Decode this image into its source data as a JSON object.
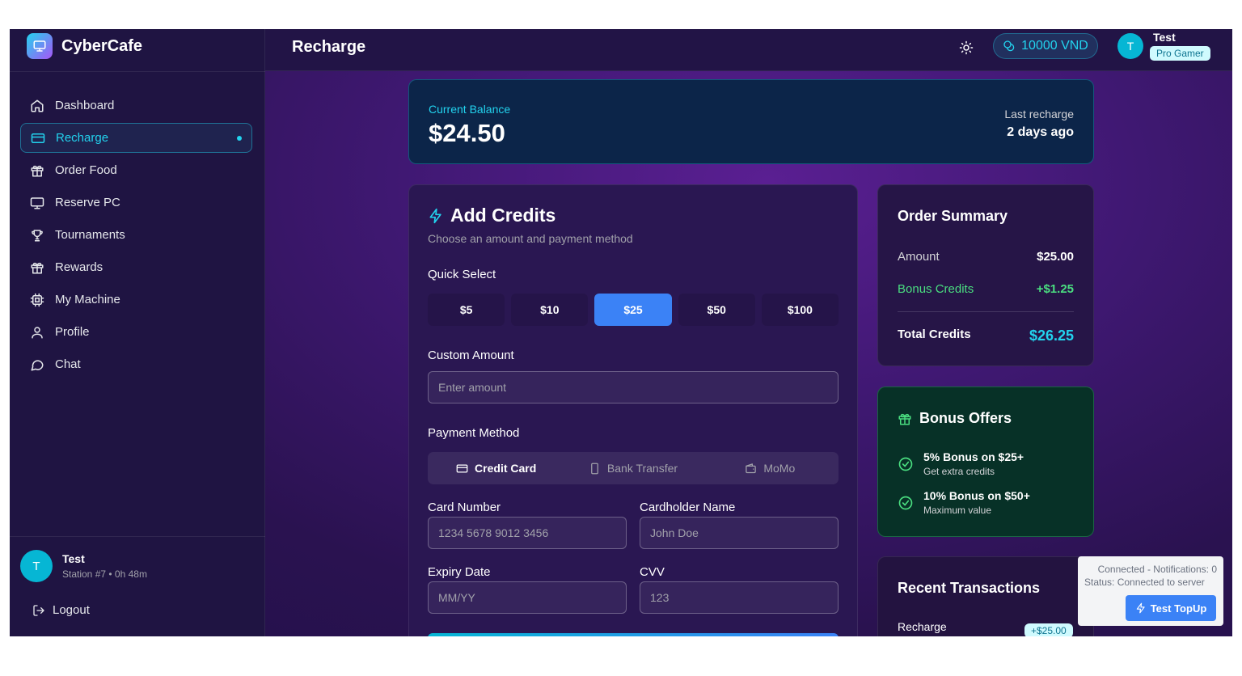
{
  "brand": {
    "name": "CyberCafe"
  },
  "header": {
    "title": "Recharge",
    "balance": "10000 VND",
    "user_initial": "T",
    "user_name": "Test",
    "user_badge": "Pro Gamer"
  },
  "sidebar": {
    "items": [
      {
        "label": "Dashboard",
        "icon": "home-icon"
      },
      {
        "label": "Recharge",
        "icon": "credit-card-icon",
        "active": true
      },
      {
        "label": "Order Food",
        "icon": "gift-icon"
      },
      {
        "label": "Reserve PC",
        "icon": "monitor-icon"
      },
      {
        "label": "Tournaments",
        "icon": "trophy-icon"
      },
      {
        "label": "Rewards",
        "icon": "gift-icon"
      },
      {
        "label": "My Machine",
        "icon": "cpu-icon"
      },
      {
        "label": "Profile",
        "icon": "user-icon"
      },
      {
        "label": "Chat",
        "icon": "chat-icon"
      }
    ],
    "user": {
      "initial": "T",
      "name": "Test",
      "status": "Station #7 • 0h 48m"
    },
    "logout": "Logout"
  },
  "balance_card": {
    "label": "Current Balance",
    "amount": "$24.50",
    "last_label": "Last recharge",
    "last_value": "2 days ago"
  },
  "credits": {
    "title": "Add Credits",
    "subtitle": "Choose an amount and payment method",
    "quick_label": "Quick Select",
    "quick_amounts": [
      "$5",
      "$10",
      "$25",
      "$50",
      "$100"
    ],
    "selected_amount": "$25",
    "custom_label": "Custom Amount",
    "custom_placeholder": "Enter amount",
    "payment_label": "Payment Method",
    "payment_methods": [
      {
        "label": "Credit Card",
        "icon": "credit-card-icon"
      },
      {
        "label": "Bank Transfer",
        "icon": "phone-icon"
      },
      {
        "label": "MoMo",
        "icon": "wallet-icon"
      }
    ],
    "selected_method": "Credit Card",
    "card_number_label": "Card Number",
    "card_number_placeholder": "1234 5678 9012 3456",
    "holder_label": "Cardholder Name",
    "holder_placeholder": "John Doe",
    "expiry_label": "Expiry Date",
    "expiry_placeholder": "MM/YY",
    "cvv_label": "CVV",
    "cvv_placeholder": "123"
  },
  "summary": {
    "title": "Order Summary",
    "amount_label": "Amount",
    "amount_value": "$25.00",
    "bonus_label": "Bonus Credits",
    "bonus_value": "+$1.25",
    "total_label": "Total Credits",
    "total_value": "$26.25"
  },
  "offers": {
    "title": "Bonus Offers",
    "items": [
      {
        "title": "5% Bonus on $25+",
        "subtitle": "Get extra credits"
      },
      {
        "title": "10% Bonus on $50+",
        "subtitle": "Maximum value"
      }
    ]
  },
  "transactions": {
    "title": "Recent Transactions",
    "items": [
      {
        "name": "Recharge",
        "amount": "+$25.00"
      }
    ]
  },
  "toast": {
    "line1": "Connected - Notifications: 0",
    "line2": "Status: Connected to server",
    "button": "Test TopUp"
  },
  "colors": {
    "accent": "#22d3ee",
    "primary": "#3b82f6",
    "bonus": "#4ade80",
    "sidebar_bg": "#1f1442"
  }
}
